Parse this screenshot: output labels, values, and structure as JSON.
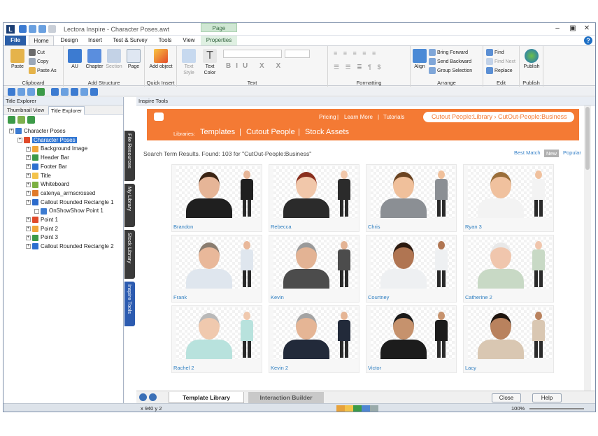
{
  "window": {
    "title": "Lectora Inspire - Character Poses.awt",
    "context_tab": "Page"
  },
  "tabs": [
    "File",
    "Home",
    "Design",
    "Insert",
    "Test & Survey",
    "Tools",
    "View",
    "Properties"
  ],
  "ribbon": {
    "clipboard": {
      "paste": "Paste",
      "cut": "Cut",
      "copy": "Copy",
      "paste_as": "Paste As",
      "label": "Clipboard"
    },
    "add_structure": {
      "au": "AU",
      "chapter": "Chapter",
      "section": "Section",
      "page": "Page",
      "label": "Add Structure"
    },
    "quick_insert": {
      "add_object": "Add object",
      "label": "Quick Insert"
    },
    "text": {
      "text_style": "Text Style",
      "text_color": "Text Color",
      "label": "Text"
    },
    "formatting": {
      "label": "Formatting"
    },
    "arrange": {
      "align": "Align",
      "bring_forward": "Bring Forward",
      "send_backward": "Send Backward",
      "group_selection": "Group Selection",
      "label": "Arrange"
    },
    "edit": {
      "find": "Find",
      "find_next": "Find Next",
      "replace": "Replace",
      "label": "Edit"
    },
    "publish": {
      "publish": "Publish",
      "label": "Publish"
    }
  },
  "left": {
    "panel_title": "Title Explorer",
    "tab1": "Thumbnail View",
    "tab2": "Title Explorer",
    "tree": [
      {
        "label": "Character Poses",
        "depth": 0
      },
      {
        "label": "Character Poses",
        "depth": 1,
        "selected": true
      },
      {
        "label": "Background Image",
        "depth": 2
      },
      {
        "label": "Header Bar",
        "depth": 2
      },
      {
        "label": "Footer Bar",
        "depth": 2
      },
      {
        "label": "Title",
        "depth": 2
      },
      {
        "label": "Whiteboard",
        "depth": 2
      },
      {
        "label": "catenya_armscrossed",
        "depth": 2
      },
      {
        "label": "Callout Rounded Rectangle 1",
        "depth": 2
      },
      {
        "label": "OnShowShow Point 1",
        "depth": 3
      },
      {
        "label": "Point 1",
        "depth": 2
      },
      {
        "label": "Point 2",
        "depth": 2
      },
      {
        "label": "Point 3",
        "depth": 2
      },
      {
        "label": "Callout Rounded Rectangle 2",
        "depth": 2
      }
    ]
  },
  "side_tabs": [
    "File Resources",
    "My Library",
    "Stock Library",
    "Inspire Tools"
  ],
  "center": {
    "panel_title": "Inspire Tools",
    "nav": {
      "pricing": "Pricing",
      "learn_more": "Learn More",
      "tutorials": "Tutorials"
    },
    "libraries_label": "Libraries:",
    "lib_tabs": [
      "Templates",
      "Cutout People",
      "Stock Assets"
    ],
    "breadcrumb": "Cutout People:Library  ›  CutOut-People:Business",
    "search_text": "Search Term Results. Found: 103 for \"CutOut-People:Business\"",
    "sort": {
      "best": "Best Match",
      "new": "New",
      "popular": "Popular"
    },
    "cards": [
      {
        "name": "Brandon",
        "skin": "#e6b597",
        "hair": "#3b2414",
        "suit": "#1f1f1f"
      },
      {
        "name": "Rebecca",
        "skin": "#f1c7aa",
        "hair": "#8a2f1e",
        "suit": "#2b2b2b"
      },
      {
        "name": "Chris",
        "skin": "#f0c09b",
        "hair": "#6b4422",
        "suit": "#8b8f94"
      },
      {
        "name": "Ryan 3",
        "skin": "#f0c19e",
        "hair": "#9a6e3a",
        "suit": "#f3f3f3"
      },
      {
        "name": "Frank",
        "skin": "#e9b89a",
        "hair": "#8a7d70",
        "suit": "#dfe6ee"
      },
      {
        "name": "Kevin",
        "skin": "#e3b394",
        "hair": "#9a9a9a",
        "suit": "#4c4c4c"
      },
      {
        "name": "Courtney",
        "skin": "#b07552",
        "hair": "#2c1a10",
        "suit": "#eef0f2"
      },
      {
        "name": "Catherine 2",
        "skin": "#f0c6ad",
        "hair": "#e8e8e8",
        "suit": "#c8d9c5"
      },
      {
        "name": "Rachel 2",
        "skin": "#f0c9ae",
        "hair": "#b9b9b9",
        "suit": "#b8e2dd"
      },
      {
        "name": "Kevin 2",
        "skin": "#e5b595",
        "hair": "#a4a4a4",
        "suit": "#222a3a"
      },
      {
        "name": "Victor",
        "skin": "#c6926d",
        "hair": "#1a1a1a",
        "suit": "#1c1c1c"
      },
      {
        "name": "Lacy",
        "skin": "#b9825e",
        "hair": "#1d140e",
        "suit": "#d9c7b2"
      }
    ],
    "bottom_tabs": {
      "template_library": "Template Library",
      "interaction_builder": "Interaction Builder"
    },
    "buttons": {
      "close": "Close",
      "help": "Help"
    }
  },
  "status": {
    "coords": "x 940  y 2",
    "zoom": "100%"
  }
}
